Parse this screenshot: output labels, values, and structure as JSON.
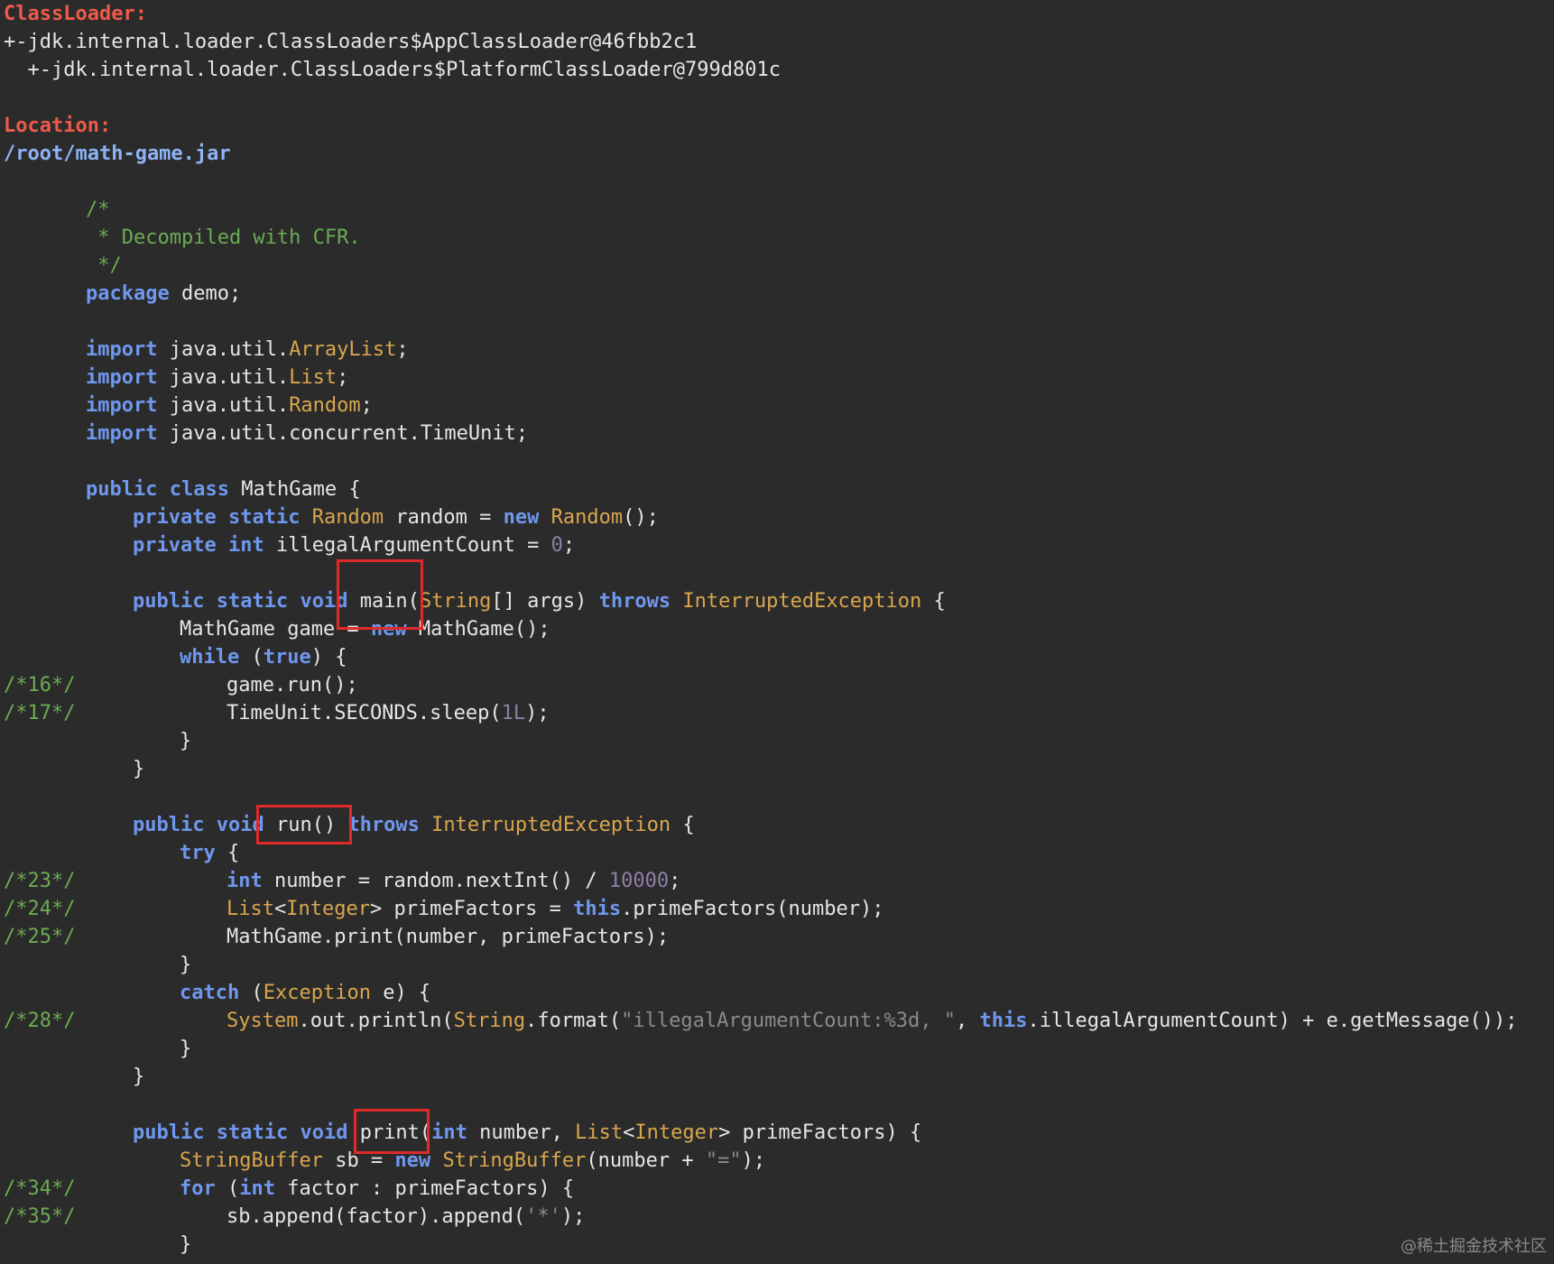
{
  "header": {
    "classloader_label": "ClassLoader:",
    "loader_line_1": "+-jdk.internal.loader.ClassLoaders$AppClassLoader@46fbb2c1",
    "loader_line_2": "  +-jdk.internal.loader.ClassLoaders$PlatformClassLoader@799d801c",
    "location_label": "Location:",
    "location_path": "/root/math-game.jar"
  },
  "code": {
    "comment_open": "/*",
    "comment_body": " * Decompiled with CFR.",
    "comment_close": " */",
    "kw_package": "package",
    "package_name": " demo;",
    "kw_import": "import",
    "import_prefix": " java.util.",
    "type_arraylist": "ArrayList",
    "type_list": "List",
    "type_random": "Random",
    "import_concurrent": " java.util.concurrent.TimeUnit;",
    "semicolon": ";",
    "kw_public": "public",
    "kw_class": "class",
    "class_decl_rest": " MathGame {",
    "kw_private": "private",
    "kw_static": "static",
    "field_random_name": " random = ",
    "kw_new": "new",
    "ctor_random_end": "();",
    "kw_int": "int",
    "field_count_name": " illegalArgumentCount = ",
    "num_zero": "0",
    "kw_void": "void",
    "main_sig": " main(",
    "type_string": "String",
    "main_args": "[] args) ",
    "kw_throws": "throws",
    "type_interrupted": "InterruptedException",
    "brace_open": " {",
    "main_game_decl": "MathGame game = ",
    "main_game_ctor": " MathGame();",
    "kw_while": "while",
    "kw_true": "true",
    "paren_open": " (",
    "paren_close_brace": ") {",
    "game_run": "game.run();",
    "sleep_prefix": "TimeUnit.SECONDS.sleep(",
    "num_one_l": "1L",
    "paren_semicolon": ");",
    "brace_close": "}",
    "run_sig": " run() ",
    "kw_try": "try",
    "number_assign": " number = random.nextInt() / ",
    "num_10000": "10000",
    "type_integer": "Integer",
    "lt": "<",
    "gt_prime": "> primeFactors = ",
    "kw_this": "this",
    "prime_call": ".primeFactors(number);",
    "print_call": "MathGame.print(number, primeFactors);",
    "kw_catch": "catch",
    "type_exception": "Exception",
    "catch_var": " e) {",
    "type_system": "System",
    "println_prefix": ".out.println(",
    "format_call": ".format(",
    "str_format": "\"illegalArgumentCount:%3d, \"",
    "comma_space": ", ",
    "println_rest": ".illegalArgumentCount) + e.getMessage());",
    "print_sig": " print(",
    "print_number": " number, ",
    "gt_param": "> primeFactors) {",
    "type_stringbuffer": "StringBuffer",
    "sb_decl": " sb = ",
    "sb_ctor": "(number + ",
    "str_eq": "\"=\"",
    "kw_for": "for",
    "for_rest": " factor : primeFactors) {",
    "sb_append": "sb.append(factor).append(",
    "str_star": "'*'"
  },
  "line_numbers": {
    "n16": "/*16*/",
    "n17": "/*17*/",
    "n23": "/*23*/",
    "n24": "/*24*/",
    "n25": "/*25*/",
    "n28": "/*28*/",
    "n34": "/*34*/",
    "n35": "/*35*/"
  },
  "watermark": "@稀土掘金技术社区"
}
